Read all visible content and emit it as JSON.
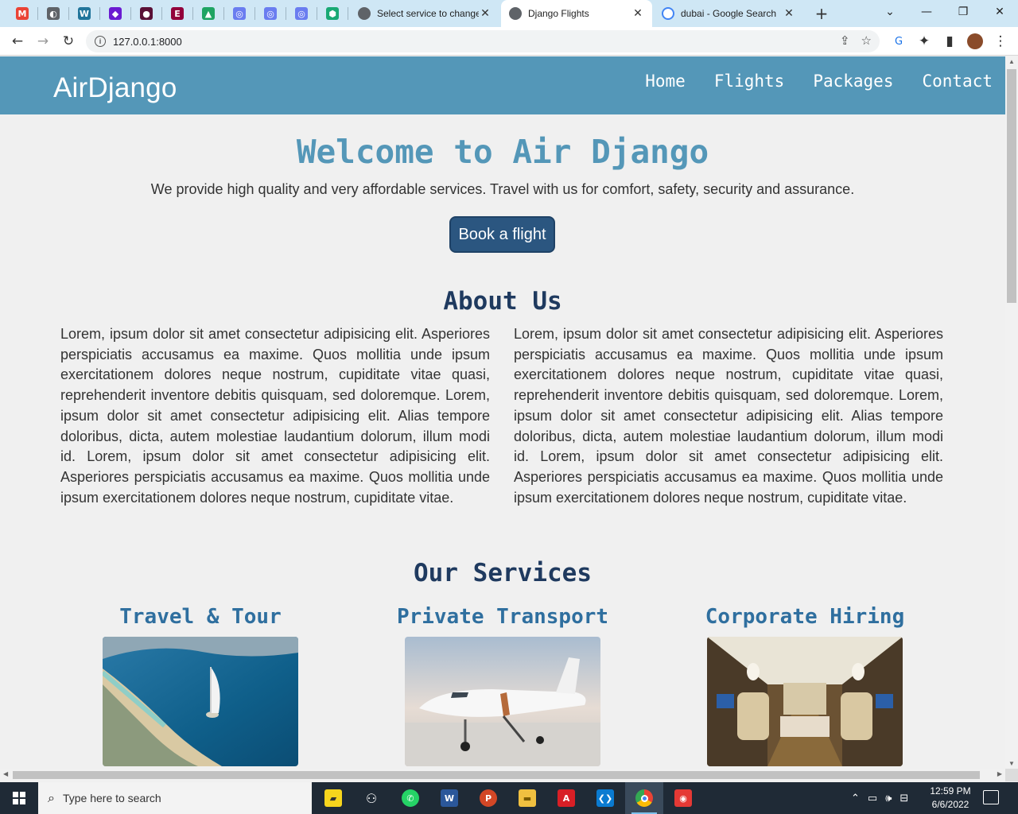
{
  "browser": {
    "pinned_tabs": [
      {
        "name": "gmail-icon",
        "glyph": "M",
        "color": "#ea4335"
      },
      {
        "name": "globe-icon",
        "glyph": "◐",
        "color": "#5f6368"
      },
      {
        "name": "wordpress-icon",
        "glyph": "W",
        "color": "#21759b"
      },
      {
        "name": "diamond-icon",
        "glyph": "◆",
        "color": "#6a1bd1"
      },
      {
        "name": "circle-app-icon",
        "glyph": "●",
        "color": "#5a1036"
      },
      {
        "name": "elementor-icon",
        "glyph": "E",
        "color": "#92003b"
      },
      {
        "name": "google-drive-icon",
        "glyph": "▲",
        "color": "#1fa463"
      },
      {
        "name": "app-icon-1",
        "glyph": "◎",
        "color": "#6a7df0"
      },
      {
        "name": "app-icon-2",
        "glyph": "◎",
        "color": "#6a7df0"
      },
      {
        "name": "app-icon-3",
        "glyph": "◎",
        "color": "#6a7df0"
      },
      {
        "name": "shield-app-icon",
        "glyph": "⬢",
        "color": "#19a974"
      }
    ],
    "tabs": [
      {
        "title": "Select service to change",
        "active": false
      },
      {
        "title": "Django Flights",
        "active": true
      },
      {
        "title": "dubai - Google Search",
        "active": false
      }
    ],
    "new_tab": "+",
    "url": "127.0.0.1:8000"
  },
  "site": {
    "logo": "AirDjango",
    "nav": [
      "Home",
      "Flights",
      "Packages",
      "Contact"
    ],
    "welcome_title": "Welcome to Air Django",
    "tagline": "We provide high quality and very affordable services. Travel with us for comfort, safety, security and assurance.",
    "book_button": "Book a flight",
    "about": {
      "title": "About Us",
      "columns": [
        "Lorem, ipsum dolor sit amet consectetur adipisicing elit. Asperiores perspiciatis accusamus ea maxime. Quos mollitia unde ipsum exercitationem dolores neque nostrum, cupiditate vitae quasi, reprehenderit inventore debitis quisquam, sed doloremque. Lorem, ipsum dolor sit amet consectetur adipisicing elit. Alias tempore doloribus, dicta, autem molestiae laudantium dolorum, illum modi id. Lorem, ipsum dolor sit amet consectetur adipisicing elit. Asperiores perspiciatis accusamus ea maxime. Quos mollitia unde ipsum exercitationem dolores neque nostrum, cupiditate vitae.",
        "Lorem, ipsum dolor sit amet consectetur adipisicing elit. Asperiores perspiciatis accusamus ea maxime. Quos mollitia unde ipsum exercitationem dolores neque nostrum, cupiditate vitae quasi, reprehenderit inventore debitis quisquam, sed doloremque. Lorem, ipsum dolor sit amet consectetur adipisicing elit. Alias tempore doloribus, dicta, autem molestiae laudantium dolorum, illum modi id. Lorem, ipsum dolor sit amet consectetur adipisicing elit. Asperiores perspiciatis accusamus ea maxime. Quos mollitia unde ipsum exercitationem dolores neque nostrum, cupiditate vitae."
      ]
    },
    "services": {
      "title": "Our Services",
      "items": [
        {
          "title": "Travel & Tour",
          "image": "dubai-coast-photo"
        },
        {
          "title": "Private Transport",
          "image": "private-jet-photo"
        },
        {
          "title": "Corporate Hiring",
          "image": "jet-cabin-interior-photo"
        }
      ]
    },
    "colors": {
      "header": "#5497b8",
      "welcome": "#5497b8",
      "heading": "#1f3a5f",
      "service_heading": "#2f6f9f",
      "button": "#2b5680"
    }
  },
  "taskbar": {
    "search_placeholder": "Type here to search",
    "apps": [
      "sticky-notes-icon",
      "reader-icon",
      "whatsapp-icon",
      "word-icon",
      "powerpoint-icon",
      "file-explorer-icon",
      "acrobat-icon",
      "vscode-icon",
      "chrome-icon",
      "camera-app-icon"
    ],
    "time": "12:59 PM",
    "date": "6/6/2022"
  }
}
